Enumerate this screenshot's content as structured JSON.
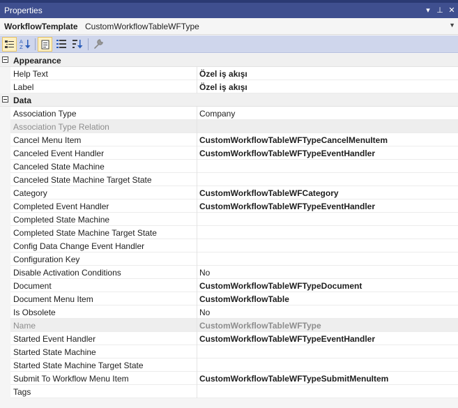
{
  "panel": {
    "title": "Properties",
    "buttons": {
      "dropdown": "▾",
      "pin": "⊥",
      "close": "✕"
    }
  },
  "selector": {
    "object_name": "WorkflowTemplate",
    "object_type": "CustomWorkflowTableWFType",
    "dropdown_glyph": "▼"
  },
  "toolbar": {
    "buttons": [
      {
        "icon": "categorized-icon",
        "active": true
      },
      {
        "icon": "alphabetical-icon",
        "active": false
      },
      {
        "icon": "properties-icon",
        "active": true
      },
      {
        "icon": "events-icon",
        "active": false
      },
      {
        "icon": "sort-icon",
        "active": false
      },
      {
        "icon": "wrench-icon",
        "active": false
      }
    ]
  },
  "categories": [
    {
      "name": "Appearance",
      "rows": [
        {
          "name": "Help Text",
          "value": "Özel iş akışı",
          "bold": true,
          "disabled": false
        },
        {
          "name": "Label",
          "value": "Özel iş akışı",
          "bold": true,
          "disabled": false
        }
      ]
    },
    {
      "name": "Data",
      "rows": [
        {
          "name": "Association Type",
          "value": "Company",
          "bold": false,
          "disabled": false
        },
        {
          "name": "Association Type Relation",
          "value": "",
          "bold": false,
          "disabled": true
        },
        {
          "name": "Cancel Menu Item",
          "value": "CustomWorkflowTableWFTypeCancelMenuItem",
          "bold": true,
          "disabled": false
        },
        {
          "name": "Canceled Event Handler",
          "value": "CustomWorkflowTableWFTypeEventHandler",
          "bold": true,
          "disabled": false
        },
        {
          "name": "Canceled State Machine",
          "value": "",
          "bold": false,
          "disabled": false
        },
        {
          "name": "Canceled State Machine Target State",
          "value": "",
          "bold": false,
          "disabled": false
        },
        {
          "name": "Category",
          "value": "CustomWorkflowTableWFCategory",
          "bold": true,
          "disabled": false
        },
        {
          "name": "Completed Event Handler",
          "value": "CustomWorkflowTableWFTypeEventHandler",
          "bold": true,
          "disabled": false
        },
        {
          "name": "Completed State Machine",
          "value": "",
          "bold": false,
          "disabled": false
        },
        {
          "name": "Completed State Machine Target State",
          "value": "",
          "bold": false,
          "disabled": false
        },
        {
          "name": "Config Data Change Event Handler",
          "value": "",
          "bold": false,
          "disabled": false
        },
        {
          "name": "Configuration Key",
          "value": "",
          "bold": false,
          "disabled": false
        },
        {
          "name": "Disable Activation Conditions",
          "value": "No",
          "bold": false,
          "disabled": false
        },
        {
          "name": "Document",
          "value": "CustomWorkflowTableWFTypeDocument",
          "bold": true,
          "disabled": false
        },
        {
          "name": "Document Menu Item",
          "value": "CustomWorkflowTable",
          "bold": true,
          "disabled": false
        },
        {
          "name": "Is Obsolete",
          "value": "No",
          "bold": false,
          "disabled": false
        },
        {
          "name": "Name",
          "value": "CustomWorkflowTableWFType",
          "bold": true,
          "disabled": true
        },
        {
          "name": "Started Event Handler",
          "value": "CustomWorkflowTableWFTypeEventHandler",
          "bold": true,
          "disabled": false
        },
        {
          "name": "Started State Machine",
          "value": "",
          "bold": false,
          "disabled": false
        },
        {
          "name": "Started State Machine Target State",
          "value": "",
          "bold": false,
          "disabled": false
        },
        {
          "name": "Submit To Workflow Menu Item",
          "value": "CustomWorkflowTableWFTypeSubmitMenuItem",
          "bold": true,
          "disabled": false
        },
        {
          "name": "Tags",
          "value": "",
          "bold": false,
          "disabled": false
        }
      ]
    }
  ]
}
